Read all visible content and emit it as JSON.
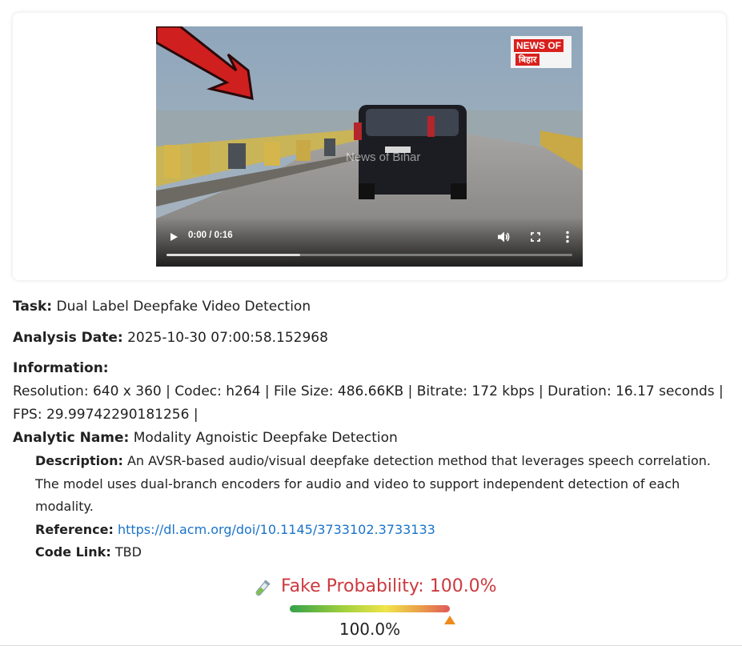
{
  "video": {
    "time_display": "0:00 / 0:16",
    "logo_line1": "NEWS OF",
    "logo_line2": "बिहार",
    "watermark": "News of Bihar",
    "buffered_fraction": 0.33
  },
  "task": {
    "label": "Task:",
    "value": "Dual Label Deepfake Video Detection"
  },
  "analysis_date": {
    "label": "Analysis Date:",
    "value": "2025-10-30 07:00:58.152968"
  },
  "information": {
    "label": "Information:",
    "value": "Resolution: 640 x 360 | Codec: h264 | File Size: 486.66KB | Bitrate: 172 kbps | Duration: 16.17 seconds | FPS: 29.99742290181256 |"
  },
  "analytic": {
    "name_label": "Analytic Name:",
    "name_value": "Modality Agnoistic Deepfake Detection",
    "description_label": "Description:",
    "description_value": "An AVSR-based audio/visual deepfake detection method that leverages speech correlation. The model uses dual-branch encoders for audio and video to support independent detection of each modality.",
    "reference_label": "Reference:",
    "reference_url": "https://dl.acm.org/doi/10.1145/3733102.3733133",
    "code_link_label": "Code Link:",
    "code_link_value": "TBD"
  },
  "result": {
    "icon": "test-tube-icon",
    "probability_label": "Fake Probability: 100.0%",
    "probability_value": "100.0%",
    "probability_fraction": 1.0,
    "label_color": "#cc3a3f",
    "marker_color": "#ef8a1a"
  }
}
